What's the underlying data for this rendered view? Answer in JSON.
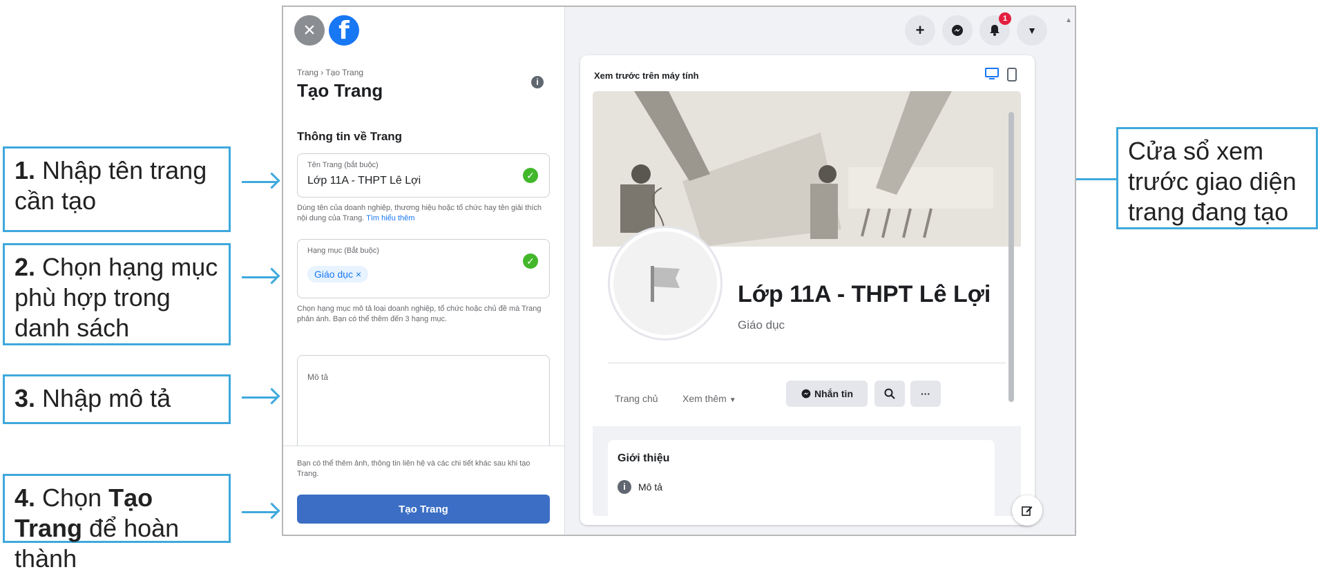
{
  "callouts": {
    "c1_num": "1.",
    "c1_text": "Nhập tên trang cần tạo",
    "c2_num": "2.",
    "c2_text": "Chọn hạng mục phù hợp trong danh sách",
    "c3_num": "3.",
    "c3_text": "Nhập mô tả",
    "c4_num": "4.",
    "c4_pre": "Chọn",
    "c4_bold": "Tạo Trang",
    "c4_post": "để hoàn thành",
    "right_text": "Cửa sổ xem trước giao diện trang đang tạo"
  },
  "left_panel": {
    "breadcrumb": "Trang › Tạo Trang",
    "title": "Tạo Trang",
    "section_title": "Thông tin về Trang",
    "name_field": {
      "label": "Tên Trang (bắt buộc)",
      "value": "Lớp 11A - THPT Lê Lợi"
    },
    "name_helper": "Dùng tên của doanh nghiệp, thương hiệu hoặc tổ chức hay tên giải thích nội dung của Trang.",
    "learn_more": "Tìm hiểu thêm",
    "category_field": {
      "label": "Hạng mục (Bắt buộc)",
      "chip": "Giáo dục"
    },
    "category_helper": "Chọn hạng mục mô tả loại doanh nghiệp, tổ chức hoặc chủ đề mà Trang phản ánh. Bạn có thể thêm đến 3 hạng mục.",
    "description_placeholder": "Mô tả",
    "footer_note": "Bạn có thể thêm ảnh, thông tin liên hệ và các chi tiết khác sau khi tạo Trang.",
    "create_button": "Tạo Trang"
  },
  "topbar": {
    "plus_icon": "+",
    "messenger_icon": "messenger-icon",
    "notification_count": "1",
    "menu_icon": "chevron-down-icon"
  },
  "preview": {
    "title": "Xem trước trên máy tính",
    "page_name": "Lớp 11A - THPT Lê Lợi",
    "page_category": "Giáo dục",
    "tab_home": "Trang chủ",
    "tab_more": "Xem thêm",
    "message_button": "Nhắn tin",
    "about_title": "Giới thiệu",
    "about_description": "Mô tả"
  },
  "colors": {
    "accent": "#3ea8dc",
    "facebook_blue": "#1877f2",
    "create_button": "#3b6ec4",
    "check_green": "#42b72a",
    "badge_red": "#e41e3f"
  }
}
